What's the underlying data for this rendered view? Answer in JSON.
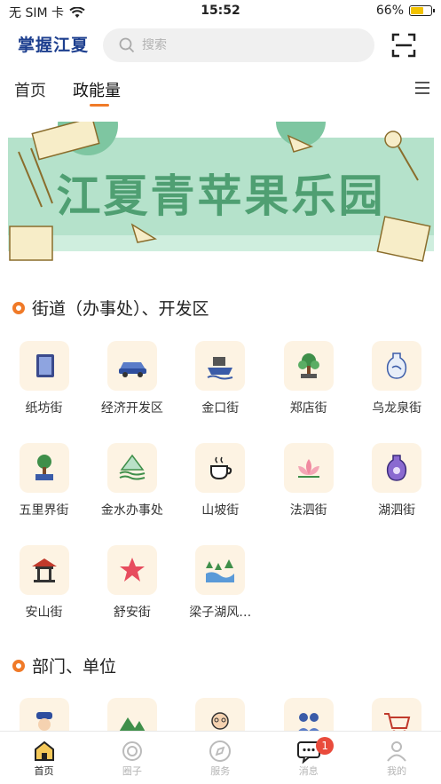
{
  "status_bar": {
    "carrier": "无 SIM 卡",
    "time": "15:52",
    "battery": "66%",
    "battery_level": 0.66
  },
  "header": {
    "logo": "掌握江夏",
    "search_placeholder": "搜索"
  },
  "tabs": [
    {
      "label": "首页"
    },
    {
      "label": "政能量"
    }
  ],
  "banner": {
    "title": "江夏青苹果乐园"
  },
  "sections": [
    {
      "title": "街道（办事处）、开发区",
      "items": [
        {
          "label": "纸坊街",
          "icon": "book-icon"
        },
        {
          "label": "经济开发区",
          "icon": "car-icon"
        },
        {
          "label": "金口街",
          "icon": "ship-icon"
        },
        {
          "label": "郑店街",
          "icon": "bonsai-icon"
        },
        {
          "label": "乌龙泉街",
          "icon": "vase-icon"
        },
        {
          "label": "五里界街",
          "icon": "tree-pot-icon"
        },
        {
          "label": "金水办事处",
          "icon": "water-icon"
        },
        {
          "label": "山坡街",
          "icon": "tea-icon"
        },
        {
          "label": "法泗街",
          "icon": "lotus-icon"
        },
        {
          "label": "湖泗街",
          "icon": "porcelain-icon"
        },
        {
          "label": "安山街",
          "icon": "pavilion-icon"
        },
        {
          "label": "舒安街",
          "icon": "star-icon"
        },
        {
          "label": "梁子湖风…",
          "icon": "landscape-icon"
        }
      ]
    },
    {
      "title": "部门、单位",
      "items": [
        {
          "label": "",
          "icon": "police-icon"
        },
        {
          "label": "",
          "icon": "mountain-icon"
        },
        {
          "label": "",
          "icon": "elder-icon"
        },
        {
          "label": "",
          "icon": "people-icon"
        },
        {
          "label": "",
          "icon": "cart-icon"
        }
      ]
    }
  ],
  "bottom_nav": [
    {
      "label": "首页",
      "icon": "home-icon"
    },
    {
      "label": "圈子",
      "icon": "circle-icon"
    },
    {
      "label": "服务",
      "icon": "compass-icon"
    },
    {
      "label": "消息",
      "icon": "message-icon",
      "badge": "1"
    },
    {
      "label": "我的",
      "icon": "user-icon"
    }
  ],
  "colors": {
    "accent": "#f07a28",
    "logo": "#1d3f8f",
    "banner_green": "#b5e2cb",
    "banner_text": "#4f9f72",
    "icon_bg": "#fdf3e3"
  }
}
